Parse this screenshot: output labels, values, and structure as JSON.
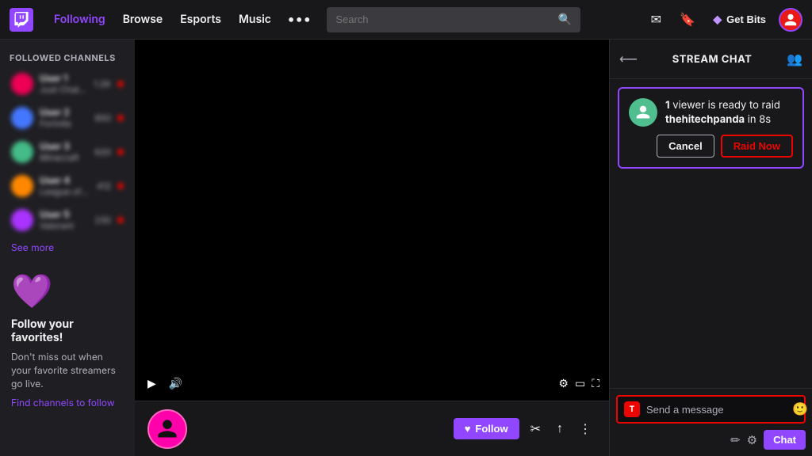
{
  "nav": {
    "links": [
      {
        "label": "Following",
        "active": true
      },
      {
        "label": "Browse"
      },
      {
        "label": "Esports"
      },
      {
        "label": "Music"
      }
    ],
    "more_label": "•••",
    "search_placeholder": "Search",
    "bits_label": "Get Bits"
  },
  "sidebar": {
    "section_label": "FOLLOWED CHANNELS",
    "items": [
      {
        "name": "User 1",
        "game": "Just Chatting",
        "viewers": "1.2K"
      },
      {
        "name": "User 2",
        "game": "Fortnite",
        "viewers": "850"
      },
      {
        "name": "User 3",
        "game": "Minecraft",
        "viewers": "620"
      },
      {
        "name": "User 4",
        "game": "League of Legends",
        "viewers": "412"
      },
      {
        "name": "User 5",
        "game": "Valorant",
        "viewers": "230"
      }
    ],
    "see_more": "See more",
    "promo": {
      "title": "Follow your favorites!",
      "subtitle": "Don't miss out when your favorite streamers go live.",
      "link": "Find channels to follow"
    }
  },
  "chat": {
    "header_title": "STREAM CHAT",
    "raid": {
      "viewers_count": "1",
      "viewers_label": "viewer",
      "raid_text": "is ready to raid",
      "channel": "thehitechpanda",
      "countdown": "in 8s",
      "cancel_label": "Cancel",
      "raid_now_label": "Raid Now"
    },
    "input_placeholder": "Send a message",
    "send_label": "Chat"
  },
  "channel": {
    "follow_label": "Follow",
    "follow_icon": "♥"
  },
  "video": {
    "play_icon": "▶",
    "mute_icon": "🔊"
  }
}
